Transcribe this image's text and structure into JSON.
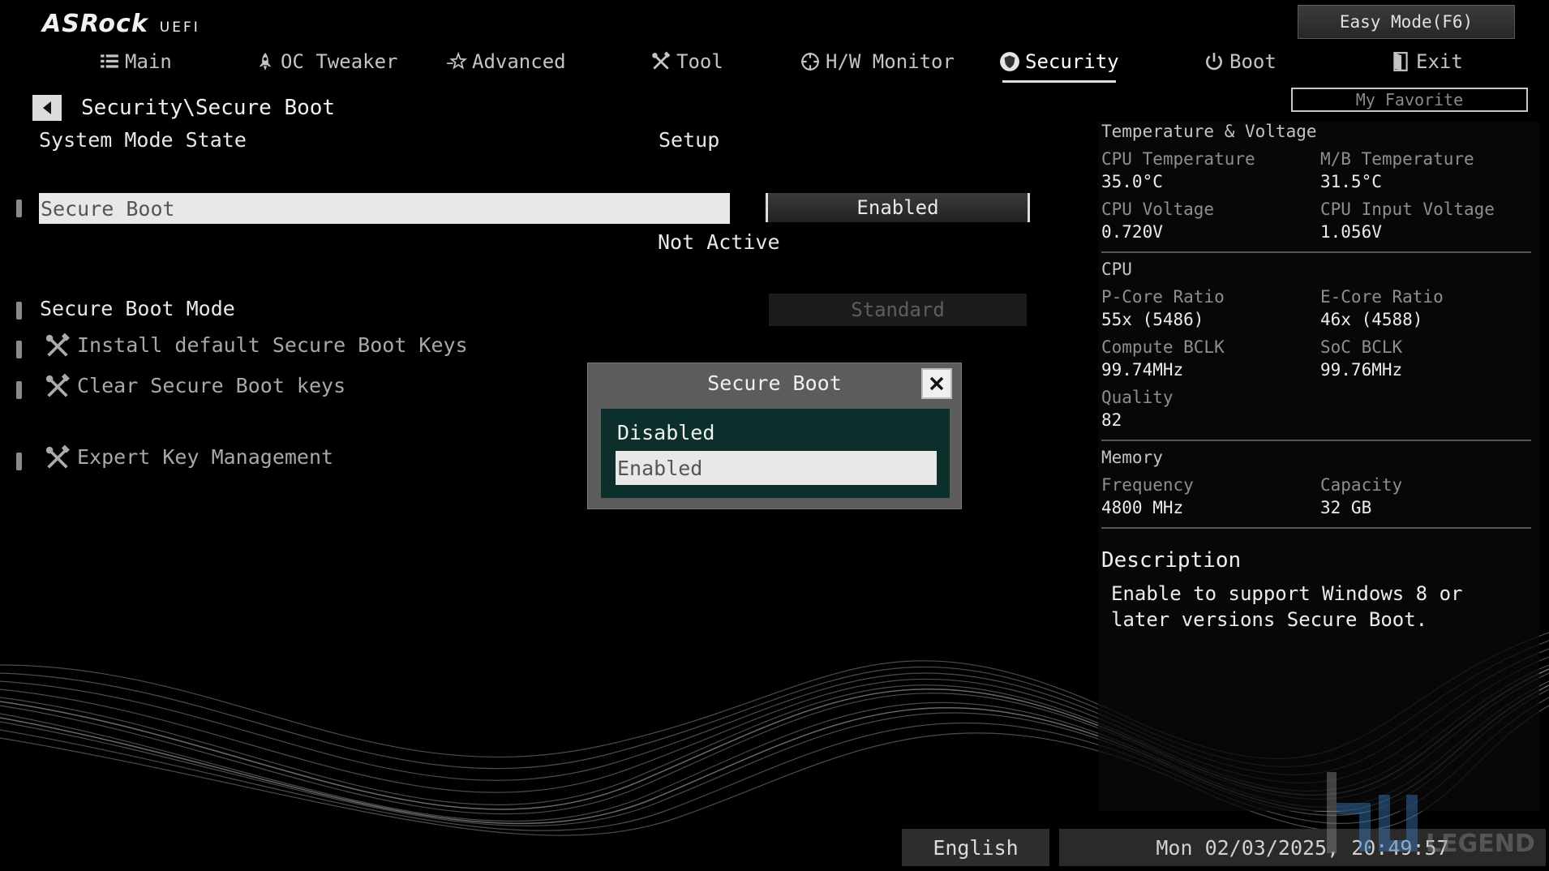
{
  "header": {
    "logo_text": "ASRock",
    "logo_sub": "UEFI",
    "easy_mode_label": "Easy Mode(F6)",
    "my_favorite_label": "My Favorite"
  },
  "tabs": [
    {
      "label": "Main",
      "icon": "list-icon"
    },
    {
      "label": "OC Tweaker",
      "icon": "rocket-icon"
    },
    {
      "label": "Advanced",
      "icon": "star-icon"
    },
    {
      "label": "Tool",
      "icon": "tools-icon"
    },
    {
      "label": "H/W Monitor",
      "icon": "crosshair-icon"
    },
    {
      "label": "Security",
      "icon": "shield-icon",
      "active": true
    },
    {
      "label": "Boot",
      "icon": "power-icon"
    },
    {
      "label": "Exit",
      "icon": "exit-icon"
    }
  ],
  "breadcrumb": "Security\\Secure Boot",
  "settings": {
    "system_mode_label": "System Mode State",
    "system_mode_value": "Setup",
    "secure_boot_label": "Secure Boot",
    "secure_boot_value": "Enabled",
    "secure_boot_status": "Not Active",
    "secure_boot_mode_label": "Secure Boot Mode",
    "secure_boot_mode_value": "Standard",
    "install_keys_label": "Install default Secure Boot Keys",
    "clear_keys_label": "Clear Secure Boot keys",
    "expert_key_label": "Expert Key Management"
  },
  "dialog": {
    "title": "Secure Boot",
    "options": [
      "Disabled",
      "Enabled"
    ],
    "selected": "Enabled"
  },
  "panel": {
    "temp_voltage": {
      "title": "Temperature & Voltage",
      "cpu_temp_label": "CPU Temperature",
      "cpu_temp": "35.0°C",
      "mb_temp_label": "M/B Temperature",
      "mb_temp": "31.5°C",
      "cpu_volt_label": "CPU Voltage",
      "cpu_volt": "0.720V",
      "cpu_input_volt_label": "CPU Input Voltage",
      "cpu_input_volt": "1.056V"
    },
    "cpu": {
      "title": "CPU",
      "pcore_label": "P-Core Ratio",
      "pcore": "55x (5486)",
      "ecore_label": "E-Core Ratio",
      "ecore": "46x (4588)",
      "bclk_label": "Compute BCLK",
      "bclk": "99.74MHz",
      "soc_label": "SoC BCLK",
      "soc": "99.76MHz",
      "quality_label": "Quality",
      "quality": "82"
    },
    "memory": {
      "title": "Memory",
      "freq_label": "Frequency",
      "freq": "4800 MHz",
      "cap_label": "Capacity",
      "cap": "32 GB"
    },
    "description": {
      "title": "Description",
      "text": "Enable to support Windows 8 or later versions Secure Boot."
    }
  },
  "footer": {
    "language": "English",
    "datetime": "Mon 02/03/2025, 20:49:57"
  },
  "colors": {
    "dialog_list_bg": "#0c2f2b",
    "highlight_bg": "#e8e8e8",
    "background": "#000000"
  }
}
